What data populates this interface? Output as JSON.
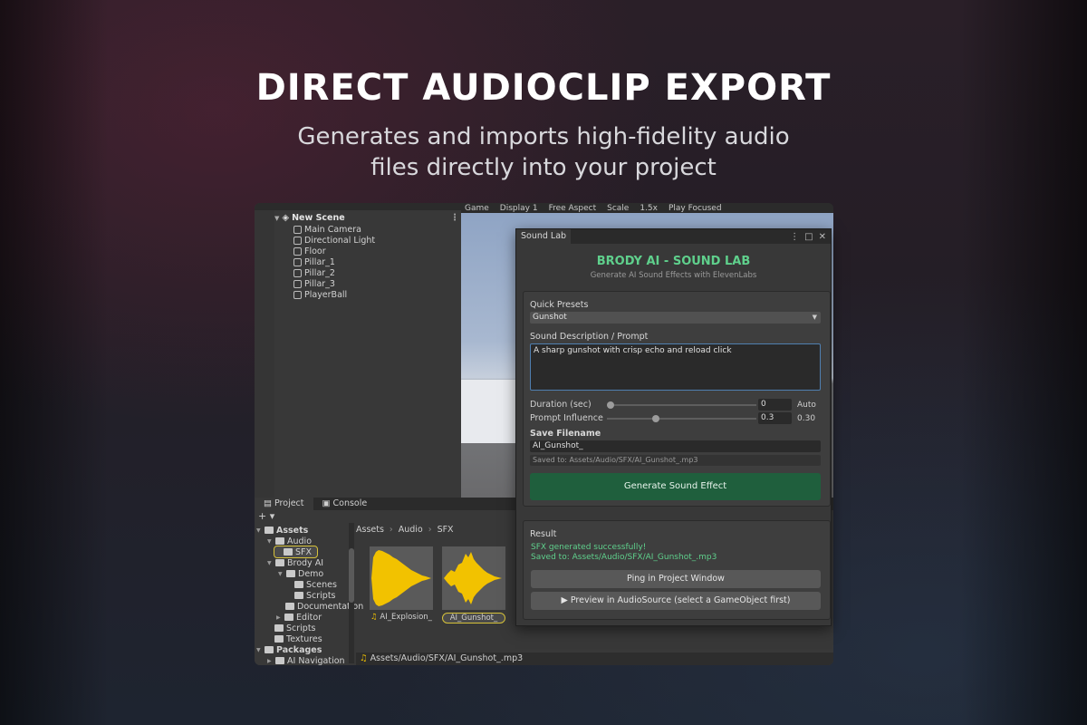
{
  "banner": {
    "headline": "DIRECT AUDIOCLIP EXPORT",
    "subline": "Generates and imports high-fidelity audio files directly into your project"
  },
  "hierarchy": {
    "scene_name": "New Scene",
    "items": [
      "Main Camera",
      "Directional Light",
      "Floor",
      "Pillar_1",
      "Pillar_2",
      "Pillar_3",
      "PlayerBall"
    ]
  },
  "game_toolbar": {
    "tab": "Game",
    "display": "Display 1",
    "aspect": "Free Aspect",
    "scale_label": "Scale",
    "scale_value": "1.5x",
    "play_mode": "Play Focused"
  },
  "project": {
    "tabs": [
      "Project",
      "Console"
    ],
    "add_label": "+ ▾",
    "tree": {
      "assets": "Assets",
      "audio": "Audio",
      "sfx": "SFX",
      "brody": "Brody AI",
      "demo": "Demo",
      "scenes": "Scenes",
      "scripts_demo": "Scripts",
      "docs": "Documentation",
      "editor": "Editor",
      "scripts": "Scripts",
      "textures": "Textures",
      "packages": "Packages",
      "ainav": "AI Navigation"
    },
    "breadcrumb": [
      "Assets",
      "Audio",
      "SFX"
    ],
    "assets": [
      {
        "name": "AI_Explosion_",
        "selected": false
      },
      {
        "name": "AI_Gunshot_",
        "selected": true
      }
    ],
    "selected_path": "Assets/Audio/SFX/AI_Gunshot_.mp3",
    "wave_color": "#f2c200"
  },
  "soundlab": {
    "tab_label": "Sound Lab",
    "title": "BRODY AI - SOUND LAB",
    "subtitle": "Generate AI Sound Effects with ElevenLabs",
    "presets_label": "Quick Presets",
    "preset_value": "Gunshot",
    "prompt_label": "Sound Description / Prompt",
    "prompt_value": "A sharp gunshot with crisp echo and reload click",
    "duration_label": "Duration (sec)",
    "duration_value": "0",
    "duration_suffix": "Auto",
    "influence_label": "Prompt Influence",
    "influence_value": "0.3",
    "influence_suffix": "0.30",
    "influence_level": 0.3,
    "filename_label": "Save Filename",
    "filename_value": "AI_Gunshot_",
    "saved_hint": "Saved to: Assets/Audio/SFX/AI_Gunshot_.mp3",
    "generate_label": "Generate Sound Effect",
    "result_label": "Result",
    "result_line1": "SFX generated successfully!",
    "result_line2": "Saved to: Assets/Audio/SFX/AI_Gunshot_.mp3",
    "ping_label": "Ping in Project Window",
    "preview_label": "▶  Preview in AudioSource (select a GameObject first)",
    "accent_color": "#5fd08c",
    "button_color": "#1f5f3d"
  }
}
